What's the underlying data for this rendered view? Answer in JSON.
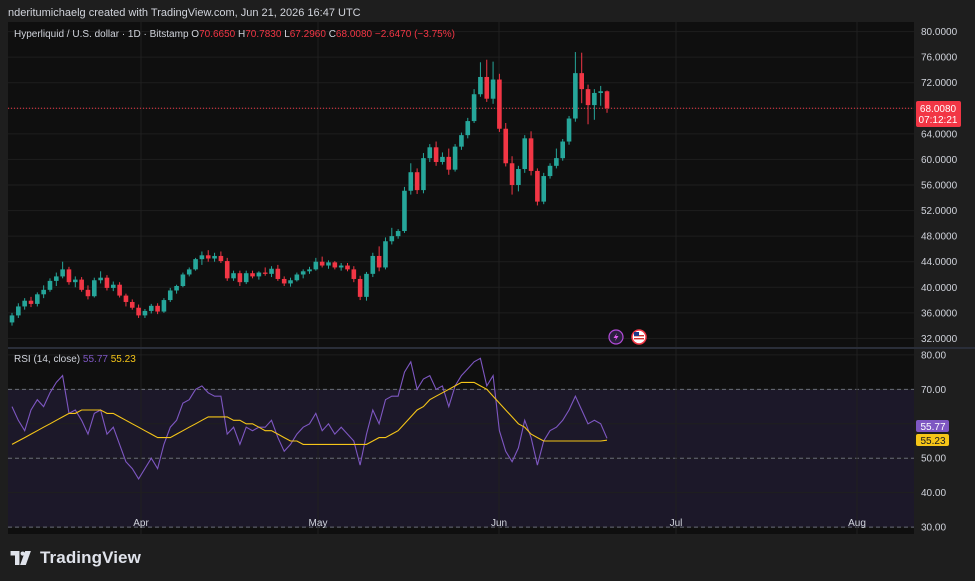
{
  "header": {
    "attribution": "nderitumichaelg created with TradingView.com, Jun 21, 2026 16:47 UTC"
  },
  "legend": {
    "symbol": "Hyperliquid / U.S. dollar · 1D · Bitstamp",
    "o_label": "O",
    "o": "70.6650",
    "h_label": "H",
    "h": "70.7830",
    "l_label": "L",
    "l": "67.2960",
    "c_label": "C",
    "c": "68.0080",
    "change": "−2.6470 (−3.75%)"
  },
  "rsi_legend": {
    "label": "RSI (14, close)",
    "rsi": "55.77",
    "ma": "55.23"
  },
  "price_badge": {
    "price": "68.0080",
    "countdown": "07:12:21"
  },
  "rsi_badges": {
    "rsi": "55.77",
    "ma": "55.23"
  },
  "footer": {
    "brand": "TradingView"
  },
  "icons": [
    "lightning-icon",
    "us-flag-icon",
    "tradingview-logo-icon"
  ],
  "colors": {
    "up": "#26a69a",
    "down": "#f23645",
    "rsi": "#7e57c2",
    "rsi_ma": "#f5c518",
    "background": "#0f0f0f"
  },
  "chart_data": [
    {
      "type": "candlestick",
      "title": "Hyperliquid / U.S. dollar · 1D · Bitstamp",
      "x_ticks": [
        "Apr",
        "May",
        "Jun",
        "Jul",
        "Aug"
      ],
      "y_ticks": [
        "80.0000",
        "76.0000",
        "72.0000",
        "68.0000",
        "64.0000",
        "60.0000",
        "56.0000",
        "52.0000",
        "48.0000",
        "44.0000",
        "40.0000",
        "36.0000",
        "32.0000"
      ],
      "ylim": [
        30.5,
        81.5
      ],
      "grid": true,
      "last_price": 68.008,
      "candles": [
        {
          "o": 34.5,
          "h": 36.0,
          "l": 34.0,
          "c": 35.6
        },
        {
          "o": 35.6,
          "h": 37.5,
          "l": 35.2,
          "c": 37.0
        },
        {
          "o": 37.0,
          "h": 38.3,
          "l": 36.5,
          "c": 37.9
        },
        {
          "o": 37.9,
          "h": 38.5,
          "l": 36.9,
          "c": 37.4
        },
        {
          "o": 37.4,
          "h": 39.2,
          "l": 37.0,
          "c": 38.9
        },
        {
          "o": 38.9,
          "h": 40.3,
          "l": 38.3,
          "c": 39.6
        },
        {
          "o": 39.6,
          "h": 41.4,
          "l": 39.3,
          "c": 41.0
        },
        {
          "o": 41.0,
          "h": 42.3,
          "l": 40.2,
          "c": 41.7
        },
        {
          "o": 41.7,
          "h": 44.0,
          "l": 41.4,
          "c": 42.8
        },
        {
          "o": 42.8,
          "h": 43.2,
          "l": 40.4,
          "c": 40.8
        },
        {
          "o": 40.8,
          "h": 41.7,
          "l": 40.0,
          "c": 41.2
        },
        {
          "o": 41.2,
          "h": 41.6,
          "l": 39.3,
          "c": 39.6
        },
        {
          "o": 39.6,
          "h": 40.3,
          "l": 38.1,
          "c": 38.6
        },
        {
          "o": 38.6,
          "h": 41.5,
          "l": 38.4,
          "c": 41.1
        },
        {
          "o": 41.1,
          "h": 42.5,
          "l": 40.6,
          "c": 41.5
        },
        {
          "o": 41.5,
          "h": 41.9,
          "l": 39.5,
          "c": 39.9
        },
        {
          "o": 39.9,
          "h": 40.9,
          "l": 39.4,
          "c": 40.4
        },
        {
          "o": 40.4,
          "h": 40.8,
          "l": 38.4,
          "c": 38.7
        },
        {
          "o": 38.7,
          "h": 39.0,
          "l": 37.0,
          "c": 37.7
        },
        {
          "o": 37.7,
          "h": 38.1,
          "l": 36.5,
          "c": 36.8
        },
        {
          "o": 36.8,
          "h": 37.3,
          "l": 35.2,
          "c": 35.6
        },
        {
          "o": 35.6,
          "h": 36.6,
          "l": 35.2,
          "c": 36.3
        },
        {
          "o": 36.3,
          "h": 37.4,
          "l": 35.9,
          "c": 37.1
        },
        {
          "o": 37.1,
          "h": 37.5,
          "l": 35.8,
          "c": 36.2
        },
        {
          "o": 36.2,
          "h": 38.3,
          "l": 36.0,
          "c": 38.0
        },
        {
          "o": 38.0,
          "h": 39.9,
          "l": 37.7,
          "c": 39.5
        },
        {
          "o": 39.5,
          "h": 40.4,
          "l": 39.0,
          "c": 40.2
        },
        {
          "o": 40.2,
          "h": 42.3,
          "l": 40.0,
          "c": 42.0
        },
        {
          "o": 42.0,
          "h": 43.1,
          "l": 41.7,
          "c": 42.8
        },
        {
          "o": 42.8,
          "h": 44.6,
          "l": 42.6,
          "c": 44.4
        },
        {
          "o": 44.4,
          "h": 45.6,
          "l": 43.5,
          "c": 45.0
        },
        {
          "o": 45.0,
          "h": 45.8,
          "l": 44.0,
          "c": 44.5
        },
        {
          "o": 44.5,
          "h": 45.4,
          "l": 44.0,
          "c": 44.9
        },
        {
          "o": 44.9,
          "h": 45.6,
          "l": 43.8,
          "c": 44.1
        },
        {
          "o": 44.1,
          "h": 44.6,
          "l": 41.0,
          "c": 41.4
        },
        {
          "o": 41.4,
          "h": 42.6,
          "l": 41.0,
          "c": 42.2
        },
        {
          "o": 42.2,
          "h": 42.6,
          "l": 40.2,
          "c": 40.8
        },
        {
          "o": 40.8,
          "h": 42.6,
          "l": 40.5,
          "c": 42.2
        },
        {
          "o": 42.2,
          "h": 42.6,
          "l": 41.4,
          "c": 41.7
        },
        {
          "o": 41.7,
          "h": 42.5,
          "l": 41.2,
          "c": 42.3
        },
        {
          "o": 42.3,
          "h": 43.1,
          "l": 41.8,
          "c": 42.1
        },
        {
          "o": 42.1,
          "h": 43.3,
          "l": 41.6,
          "c": 42.9
        },
        {
          "o": 42.9,
          "h": 43.5,
          "l": 41.0,
          "c": 41.3
        },
        {
          "o": 41.3,
          "h": 41.7,
          "l": 40.2,
          "c": 40.6
        },
        {
          "o": 40.6,
          "h": 41.5,
          "l": 40.1,
          "c": 41.1
        },
        {
          "o": 41.1,
          "h": 42.3,
          "l": 40.9,
          "c": 42.0
        },
        {
          "o": 42.0,
          "h": 42.8,
          "l": 41.4,
          "c": 42.5
        },
        {
          "o": 42.5,
          "h": 43.2,
          "l": 42.1,
          "c": 42.8
        },
        {
          "o": 42.8,
          "h": 44.6,
          "l": 42.6,
          "c": 44.0
        },
        {
          "o": 44.0,
          "h": 44.8,
          "l": 43.1,
          "c": 43.4
        },
        {
          "o": 43.4,
          "h": 44.2,
          "l": 42.9,
          "c": 43.9
        },
        {
          "o": 43.9,
          "h": 44.1,
          "l": 42.8,
          "c": 43.1
        },
        {
          "o": 43.1,
          "h": 43.8,
          "l": 42.6,
          "c": 43.4
        },
        {
          "o": 43.4,
          "h": 43.8,
          "l": 42.5,
          "c": 42.8
        },
        {
          "o": 42.8,
          "h": 43.3,
          "l": 40.8,
          "c": 41.3
        },
        {
          "o": 41.3,
          "h": 41.8,
          "l": 38.0,
          "c": 38.5
        },
        {
          "o": 38.5,
          "h": 42.4,
          "l": 37.9,
          "c": 42.1
        },
        {
          "o": 42.1,
          "h": 45.4,
          "l": 41.6,
          "c": 44.9
        },
        {
          "o": 44.9,
          "h": 46.4,
          "l": 42.5,
          "c": 43.1
        },
        {
          "o": 43.1,
          "h": 47.8,
          "l": 42.8,
          "c": 47.2
        },
        {
          "o": 47.2,
          "h": 49.3,
          "l": 46.7,
          "c": 48.0
        },
        {
          "o": 48.0,
          "h": 49.1,
          "l": 47.6,
          "c": 48.8
        },
        {
          "o": 48.8,
          "h": 55.7,
          "l": 48.5,
          "c": 55.1
        },
        {
          "o": 55.1,
          "h": 59.4,
          "l": 54.5,
          "c": 58.0
        },
        {
          "o": 58.0,
          "h": 58.6,
          "l": 54.6,
          "c": 55.2
        },
        {
          "o": 55.2,
          "h": 61.0,
          "l": 54.7,
          "c": 60.2
        },
        {
          "o": 60.2,
          "h": 62.4,
          "l": 59.6,
          "c": 61.9
        },
        {
          "o": 61.9,
          "h": 62.8,
          "l": 59.0,
          "c": 59.6
        },
        {
          "o": 59.6,
          "h": 61.1,
          "l": 59.2,
          "c": 60.4
        },
        {
          "o": 60.4,
          "h": 61.7,
          "l": 57.6,
          "c": 58.4
        },
        {
          "o": 58.4,
          "h": 62.4,
          "l": 58.1,
          "c": 62.0
        },
        {
          "o": 62.0,
          "h": 64.2,
          "l": 61.5,
          "c": 63.8
        },
        {
          "o": 63.8,
          "h": 66.5,
          "l": 63.3,
          "c": 66.0
        },
        {
          "o": 66.0,
          "h": 71.0,
          "l": 65.7,
          "c": 70.2
        },
        {
          "o": 70.2,
          "h": 75.2,
          "l": 69.8,
          "c": 72.9
        },
        {
          "o": 72.9,
          "h": 75.6,
          "l": 69.0,
          "c": 69.5
        },
        {
          "o": 69.5,
          "h": 75.3,
          "l": 68.7,
          "c": 72.5
        },
        {
          "o": 72.5,
          "h": 73.4,
          "l": 64.3,
          "c": 64.8
        },
        {
          "o": 64.8,
          "h": 65.7,
          "l": 58.9,
          "c": 59.4
        },
        {
          "o": 59.4,
          "h": 60.5,
          "l": 54.5,
          "c": 56.0
        },
        {
          "o": 56.0,
          "h": 59.0,
          "l": 55.0,
          "c": 58.5
        },
        {
          "o": 58.5,
          "h": 63.8,
          "l": 57.9,
          "c": 63.3
        },
        {
          "o": 63.3,
          "h": 64.4,
          "l": 57.5,
          "c": 58.2
        },
        {
          "o": 58.2,
          "h": 58.6,
          "l": 52.8,
          "c": 53.4
        },
        {
          "o": 53.4,
          "h": 57.9,
          "l": 53.0,
          "c": 57.4
        },
        {
          "o": 57.4,
          "h": 59.4,
          "l": 57.0,
          "c": 59.0
        },
        {
          "o": 59.0,
          "h": 61.7,
          "l": 58.6,
          "c": 60.2
        },
        {
          "o": 60.2,
          "h": 63.2,
          "l": 59.8,
          "c": 62.8
        },
        {
          "o": 62.8,
          "h": 66.8,
          "l": 62.3,
          "c": 66.4
        },
        {
          "o": 66.4,
          "h": 76.8,
          "l": 65.9,
          "c": 73.5
        },
        {
          "o": 73.5,
          "h": 76.7,
          "l": 68.8,
          "c": 71.0
        },
        {
          "o": 71.0,
          "h": 71.7,
          "l": 65.5,
          "c": 68.5
        },
        {
          "o": 68.5,
          "h": 71.0,
          "l": 66.2,
          "c": 70.4
        },
        {
          "o": 70.4,
          "h": 71.5,
          "l": 68.4,
          "c": 70.665
        },
        {
          "o": 70.665,
          "h": 70.783,
          "l": 67.296,
          "c": 68.008
        }
      ]
    },
    {
      "type": "line",
      "title": "RSI (14, close)",
      "y_ticks": [
        "80.00",
        "70.00",
        "60.00",
        "50.00",
        "40.00",
        "30.00"
      ],
      "ylim": [
        28.0,
        82.0
      ],
      "bands": [
        70,
        50,
        30
      ],
      "series": [
        {
          "name": "RSI",
          "values": [
            65,
            61,
            58,
            64,
            67,
            65,
            69,
            72,
            74,
            63,
            64,
            61,
            57,
            63,
            64,
            57,
            59,
            54,
            49,
            47,
            44,
            47,
            50,
            47,
            54,
            59,
            61,
            66,
            67,
            70,
            71,
            69,
            68,
            68,
            57,
            59,
            54,
            59,
            58,
            59,
            59,
            61,
            56,
            52,
            54,
            57,
            59,
            60,
            63,
            58,
            60,
            57,
            59,
            57,
            55,
            48,
            57,
            64,
            60,
            67,
            68,
            68,
            75,
            78,
            70,
            73,
            74,
            70,
            71,
            65,
            71,
            74,
            76,
            78,
            79,
            71,
            74,
            58,
            52,
            49,
            53,
            61,
            56,
            48,
            55,
            58,
            59,
            61,
            64,
            68,
            64,
            60,
            61,
            60,
            55.77
          ]
        },
        {
          "name": "MA",
          "values": [
            54,
            55,
            56,
            57,
            58,
            59,
            60,
            61,
            62,
            63,
            63,
            64,
            64,
            64,
            64,
            63,
            63,
            62,
            61,
            60,
            59,
            58,
            57,
            56,
            56,
            56,
            57,
            58,
            59,
            60,
            61,
            62,
            62,
            62,
            62,
            61,
            61,
            60,
            60,
            59,
            58,
            58,
            57,
            56,
            55,
            55,
            54,
            54,
            54,
            54,
            54,
            54,
            54,
            54,
            54,
            54,
            54,
            55,
            56,
            56,
            57,
            58,
            60,
            62,
            64,
            65,
            67,
            68,
            69,
            70,
            71,
            72,
            72,
            72,
            71,
            70,
            68,
            66,
            64,
            62,
            60,
            59,
            57,
            56,
            55,
            55,
            55,
            55,
            55,
            55,
            55,
            55,
            55,
            55,
            55.23
          ]
        }
      ]
    }
  ]
}
